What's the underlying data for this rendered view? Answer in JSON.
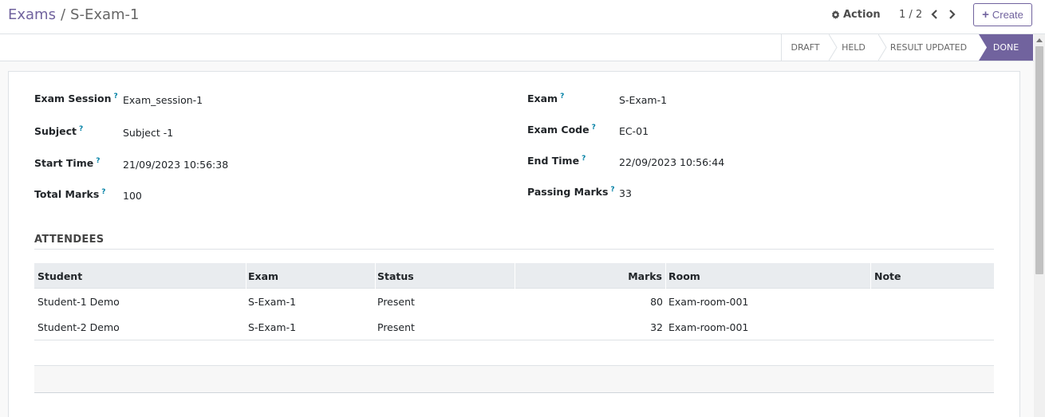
{
  "breadcrumb": {
    "parent": "Exams",
    "separator": "/",
    "current": "S-Exam-1"
  },
  "toolbar": {
    "action_label": "Action",
    "pager_value": "1 / 2",
    "create_label": "Create"
  },
  "statusbar": {
    "stages": [
      "DRAFT",
      "HELD",
      "RESULT UPDATED",
      "DONE"
    ],
    "active": "DONE"
  },
  "form": {
    "exam_session": {
      "label": "Exam Session",
      "value": "Exam_session-1"
    },
    "subject": {
      "label": "Subject",
      "value": "Subject -1"
    },
    "start_time": {
      "label": "Start Time",
      "value": "21/09/2023 10:56:38"
    },
    "total_marks": {
      "label": "Total Marks",
      "value": "100"
    },
    "exam": {
      "label": "Exam",
      "value": "S-Exam-1"
    },
    "exam_code": {
      "label": "Exam Code",
      "value": "EC-01"
    },
    "end_time": {
      "label": "End Time",
      "value": "22/09/2023 10:56:44"
    },
    "passing_marks": {
      "label": "Passing Marks",
      "value": "33"
    },
    "help_mark": "?"
  },
  "attendees": {
    "title": "ATTENDEES",
    "columns": [
      "Student",
      "Exam",
      "Status",
      "Marks",
      "Room",
      "Note"
    ],
    "rows": [
      {
        "student": "Student-1 Demo",
        "exam": "S-Exam-1",
        "status": "Present",
        "marks": "80",
        "room": "Exam-room-001",
        "note": ""
      },
      {
        "student": "Student-2 Demo",
        "exam": "S-Exam-1",
        "status": "Present",
        "marks": "32",
        "room": "Exam-room-001",
        "note": ""
      }
    ]
  },
  "colors": {
    "brand": "#71639e",
    "help": "#0180a5",
    "header_bg": "#e9ecef"
  },
  "icons": {
    "action": "gear-icon",
    "prev": "chevron-left-icon",
    "next": "chevron-right-icon",
    "create": "plus-icon"
  }
}
